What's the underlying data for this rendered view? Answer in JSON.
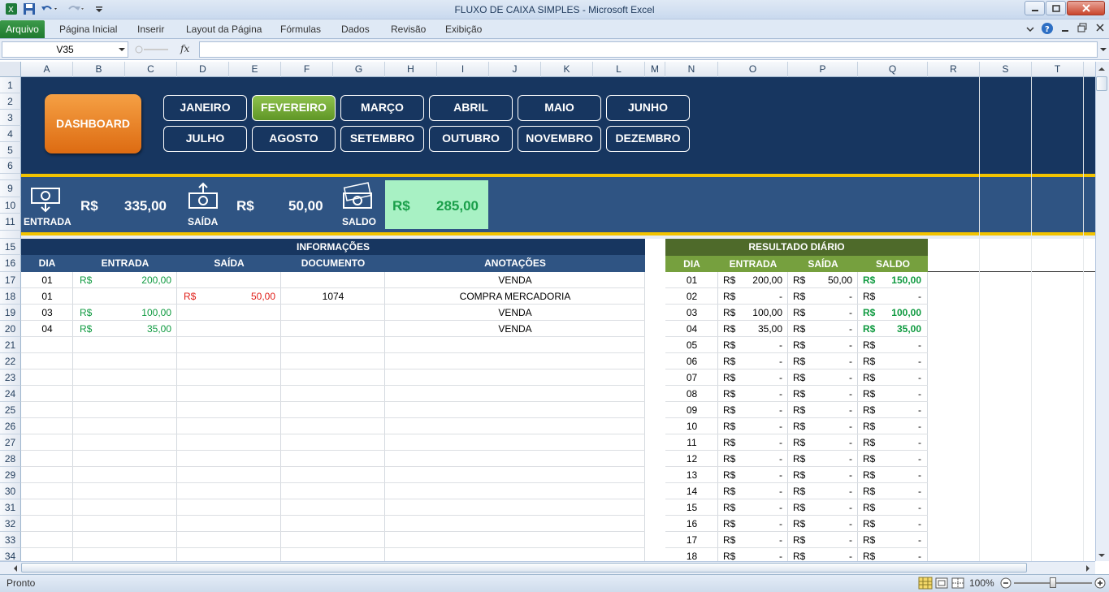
{
  "window": {
    "title": "FLUXO DE CAIXA SIMPLES  -  Microsoft Excel"
  },
  "ribbon": {
    "file_tab": "Arquivo",
    "tabs": [
      "Página Inicial",
      "Inserir",
      "Layout da Página",
      "Fórmulas",
      "Dados",
      "Revisão",
      "Exibição"
    ]
  },
  "formula_bar": {
    "name_box": "V35",
    "fx": "fx",
    "formula": ""
  },
  "columns": [
    "A",
    "B",
    "C",
    "D",
    "E",
    "F",
    "G",
    "H",
    "I",
    "J",
    "K",
    "L",
    "M",
    "N",
    "O",
    "P",
    "Q",
    "R",
    "S",
    "T"
  ],
  "rows": [
    "1",
    "2",
    "3",
    "4",
    "5",
    "6",
    "9",
    "10",
    "11",
    "15",
    "16",
    "17",
    "18",
    "19",
    "20",
    "21",
    "22",
    "23",
    "24",
    "25",
    "26",
    "27",
    "28",
    "29",
    "30",
    "31",
    "32",
    "33",
    "34"
  ],
  "nav": {
    "dashboard": "DASHBOARD",
    "months": [
      "JANEIRO",
      "FEVEREIRO",
      "MARÇO",
      "ABRIL",
      "MAIO",
      "JUNHO",
      "JULHO",
      "AGOSTO",
      "SETEMBRO",
      "OUTUBRO",
      "NOVEMBRO",
      "DEZEMBRO"
    ],
    "active_month": "FEVEREIRO"
  },
  "summary": {
    "entrada_label": "ENTRADA",
    "saida_label": "SAÍDA",
    "saldo_label": "SALDO",
    "currency": "R$",
    "entrada_value": "335,00",
    "saida_value": "50,00",
    "saldo_value": "285,00"
  },
  "info_table": {
    "title": "INFORMAÇÕES",
    "headers": [
      "DIA",
      "ENTRADA",
      "SAÍDA",
      "DOCUMENTO",
      "ANOTAÇÕES"
    ],
    "rows": [
      {
        "dia": "01",
        "entrada": "200,00",
        "saida": "",
        "documento": "",
        "anotacoes": "VENDA"
      },
      {
        "dia": "01",
        "entrada": "",
        "saida": "50,00",
        "documento": "1074",
        "anotacoes": "COMPRA MERCADORIA"
      },
      {
        "dia": "03",
        "entrada": "100,00",
        "saida": "",
        "documento": "",
        "anotacoes": "VENDA"
      },
      {
        "dia": "04",
        "entrada": "35,00",
        "saida": "",
        "documento": "",
        "anotacoes": "VENDA"
      }
    ]
  },
  "daily_table": {
    "title": "RESULTADO DIÁRIO",
    "headers": [
      "DIA",
      "ENTRADA",
      "SAÍDA",
      "SALDO"
    ],
    "rows": [
      {
        "dia": "01",
        "entrada": "200,00",
        "saida": "50,00",
        "saldo": "150,00"
      },
      {
        "dia": "02",
        "entrada": "-",
        "saida": "-",
        "saldo": "-"
      },
      {
        "dia": "03",
        "entrada": "100,00",
        "saida": "-",
        "saldo": "100,00"
      },
      {
        "dia": "04",
        "entrada": "35,00",
        "saida": "-",
        "saldo": "35,00"
      },
      {
        "dia": "05",
        "entrada": "-",
        "saida": "-",
        "saldo": "-"
      },
      {
        "dia": "06",
        "entrada": "-",
        "saida": "-",
        "saldo": "-"
      },
      {
        "dia": "07",
        "entrada": "-",
        "saida": "-",
        "saldo": "-"
      },
      {
        "dia": "08",
        "entrada": "-",
        "saida": "-",
        "saldo": "-"
      },
      {
        "dia": "09",
        "entrada": "-",
        "saida": "-",
        "saldo": "-"
      },
      {
        "dia": "10",
        "entrada": "-",
        "saida": "-",
        "saldo": "-"
      },
      {
        "dia": "11",
        "entrada": "-",
        "saida": "-",
        "saldo": "-"
      },
      {
        "dia": "12",
        "entrada": "-",
        "saida": "-",
        "saldo": "-"
      },
      {
        "dia": "13",
        "entrada": "-",
        "saida": "-",
        "saldo": "-"
      },
      {
        "dia": "14",
        "entrada": "-",
        "saida": "-",
        "saldo": "-"
      },
      {
        "dia": "15",
        "entrada": "-",
        "saida": "-",
        "saldo": "-"
      },
      {
        "dia": "16",
        "entrada": "-",
        "saida": "-",
        "saldo": "-"
      },
      {
        "dia": "17",
        "entrada": "-",
        "saida": "-",
        "saldo": "-"
      },
      {
        "dia": "18",
        "entrada": "-",
        "saida": "-",
        "saldo": "-"
      }
    ]
  },
  "status": {
    "text": "Pronto",
    "zoom": "100%"
  },
  "colors": {
    "navy": "#173660",
    "steel": "#2f5483",
    "gold": "#f2c300",
    "orange": "#e87b1e",
    "olive": "#4e6a2a",
    "green_text": "#0f9a40",
    "red_text": "#e0201a"
  }
}
